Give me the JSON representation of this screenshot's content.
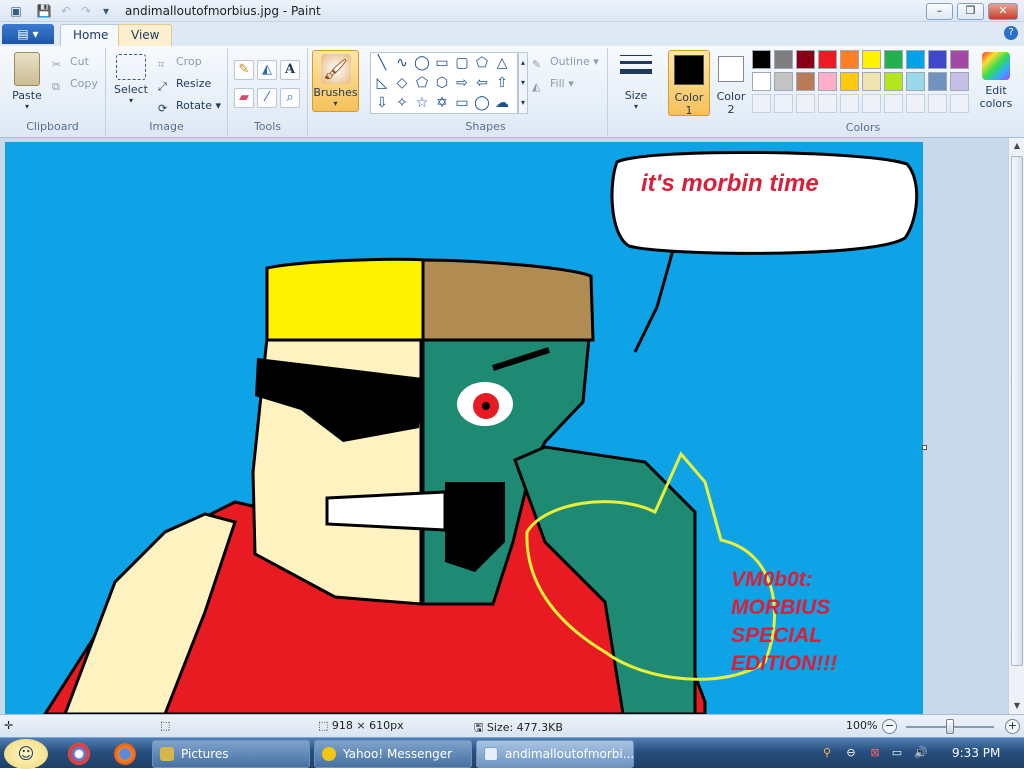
{
  "window": {
    "title": "andimalloutofmorbius.jpg - Paint",
    "minimize_glyph": "–",
    "maximize_glyph": "❐",
    "close_glyph": "✕"
  },
  "tabs": {
    "home": "Home",
    "view": "View"
  },
  "ribbon": {
    "clipboard": {
      "label": "Clipboard",
      "paste": "Paste",
      "cut": "Cut",
      "copy": "Copy"
    },
    "image": {
      "label": "Image",
      "select": "Select",
      "crop": "Crop",
      "resize": "Resize",
      "rotate": "Rotate"
    },
    "tools": {
      "label": "Tools"
    },
    "brushes": "Brushes",
    "shapes": {
      "label": "Shapes",
      "outline": "Outline",
      "fill": "Fill"
    },
    "size": "Size",
    "color1": [
      "Color",
      "1"
    ],
    "color2": [
      "Color",
      "2"
    ],
    "colors_label": "Colors",
    "edit_colors": [
      "Edit",
      "colors"
    ],
    "palette_row1": [
      "#000000",
      "#7f7f7f",
      "#880015",
      "#ed1c24",
      "#ff7f27",
      "#fff200",
      "#22b14c",
      "#00a2e8",
      "#3f48cc",
      "#a349a4"
    ],
    "palette_row2": [
      "#ffffff",
      "#c3c3c3",
      "#b97a57",
      "#ffaec9",
      "#ffc90e",
      "#efe4b0",
      "#b5e61d",
      "#99d9ea",
      "#7092be",
      "#c8bfe7"
    ]
  },
  "canvas": {
    "speech_text": "it's morbin time",
    "caption_lines": [
      "VM0b0t:",
      "MORBIUS",
      "SPECIAL",
      "EDITION!!!"
    ]
  },
  "status": {
    "dimensions": "918 × 610px",
    "size": "Size: 477.3KB",
    "zoom": "100%"
  },
  "taskbar": {
    "pictures": "Pictures",
    "yahoo": "Yahoo! Messenger",
    "paint": "andimalloutofmorbi...",
    "clock": "9:33 PM"
  },
  "colors": {
    "sky": "#0ea2e6",
    "yellow_hat": "#fff200",
    "brown_hat": "#b08c52",
    "skin": "#fef2c0",
    "green_skin": "#1e8a73",
    "shirt_red": "#e91b22",
    "caption_red": "#d8203a",
    "outline_yellow": "#e9f03a"
  }
}
